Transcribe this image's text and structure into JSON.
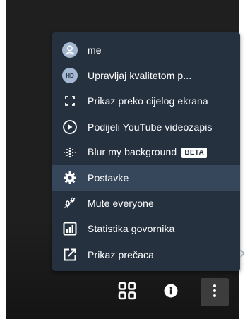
{
  "menu": {
    "items": [
      {
        "label": "me",
        "icon": "avatar-icon"
      },
      {
        "label": "Upravljaj kvalitetom p...",
        "icon": "hd-icon"
      },
      {
        "label": "Prikaz preko cijelog ekrana",
        "icon": "fullscreen-icon"
      },
      {
        "label": "Podijeli YouTube videozapis",
        "icon": "play-circle-icon"
      },
      {
        "label": "Blur my background",
        "icon": "blur-icon",
        "badge": "BETA"
      },
      {
        "label": "Postavke",
        "icon": "gear-icon",
        "highlighted": true
      },
      {
        "label": "Mute everyone",
        "icon": "mute-everyone-icon"
      },
      {
        "label": "Statistika govornika",
        "icon": "stats-icon"
      },
      {
        "label": "Prikaz prečaca",
        "icon": "shortcuts-icon"
      }
    ]
  },
  "toolbar": {
    "buttons": [
      {
        "icon": "tile-view-icon"
      },
      {
        "icon": "info-icon"
      },
      {
        "icon": "more-options-icon",
        "active": true
      }
    ]
  },
  "colors": {
    "menu_bg": "#263140",
    "menu_hover": "#36465b",
    "stage_bg": "#1f1f1f"
  }
}
